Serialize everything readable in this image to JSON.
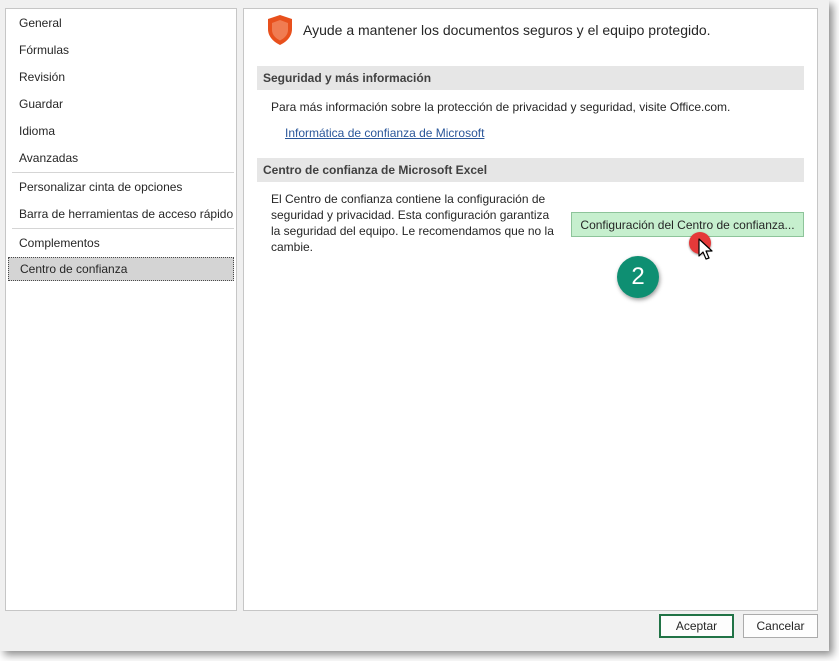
{
  "sidebar": {
    "items": [
      {
        "label": "General"
      },
      {
        "label": "Fórmulas"
      },
      {
        "label": "Revisión"
      },
      {
        "label": "Guardar"
      },
      {
        "label": "Idioma"
      },
      {
        "label": "Avanzadas"
      },
      {
        "label": "Personalizar cinta de opciones"
      },
      {
        "label": "Barra de herramientas de acceso rápido"
      },
      {
        "label": "Complementos"
      },
      {
        "label": "Centro de confianza"
      }
    ],
    "selected": "Centro de confianza"
  },
  "main": {
    "header_icon": "shield-icon",
    "header_text": "Ayude a mantener los documentos seguros y el equipo protegido.",
    "security_section": {
      "title": "Seguridad y más información",
      "description": "Para más información sobre la protección de privacidad y seguridad, visite Office.com.",
      "link_text": "Informática de confianza de Microsoft"
    },
    "trust_center_section": {
      "title": "Centro de confianza de Microsoft Excel",
      "description": "El Centro de confianza contiene la configuración de seguridad y privacidad. Esta configuración garantiza la seguridad del equipo. Le recomendamos que no la cambie.",
      "button_label": "Configuración del Centro de confianza..."
    }
  },
  "step_badge": "2",
  "footer": {
    "ok_label": "Aceptar",
    "cancel_label": "Cancelar"
  },
  "colors": {
    "accent_green": "#217346",
    "shield_orange": "#e8501d",
    "button_highlight": "#c6efce",
    "badge_teal": "#0e8f72",
    "cursor_red": "#e53939",
    "link_blue": "#2b579a"
  }
}
